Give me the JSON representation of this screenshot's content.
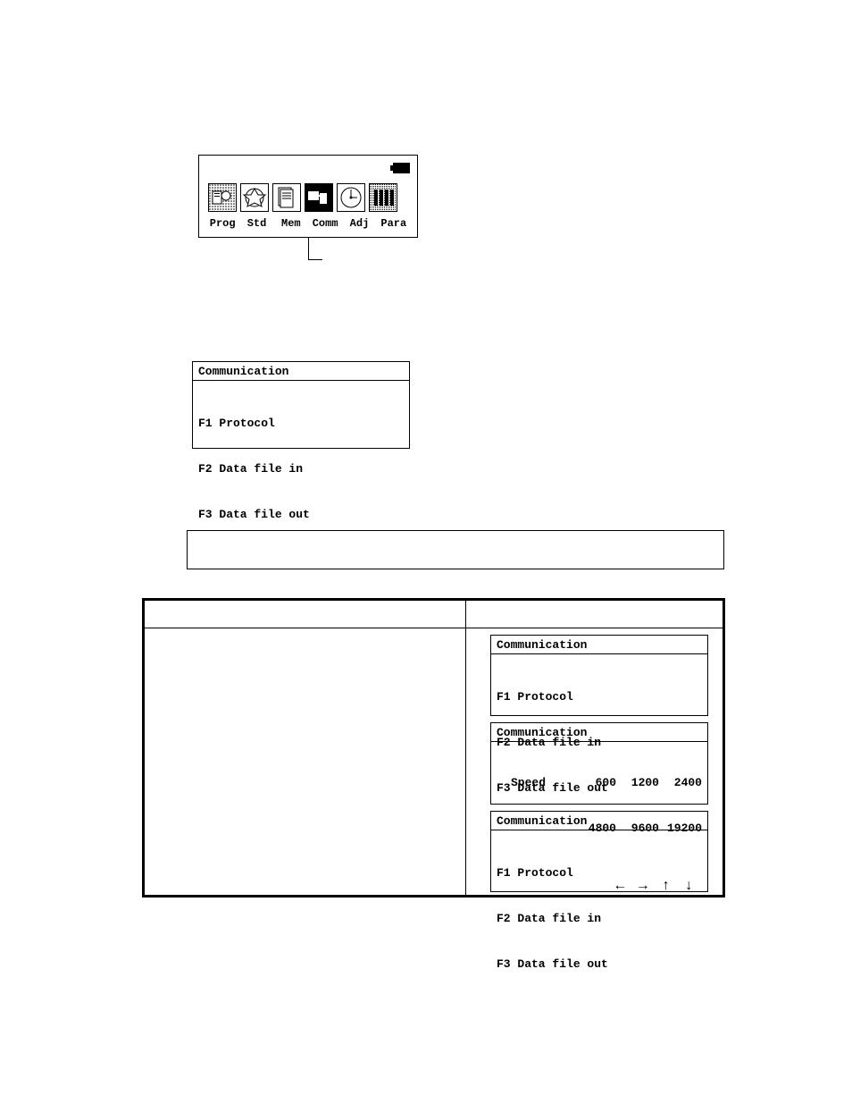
{
  "main_menu": {
    "labels": [
      "Prog",
      "Std",
      "Mem",
      "Comm",
      "Adj",
      "Para"
    ],
    "icons": [
      "prog-icon",
      "std-icon",
      "mem-icon",
      "comm-icon",
      "adj-icon",
      "para-icon"
    ],
    "battery": {
      "present": true,
      "level": "full"
    }
  },
  "comm_menu": {
    "title": "Communication",
    "items": [
      "F1 Protocol",
      "F2 Data file in",
      "F3 Data file out"
    ]
  },
  "speed_menu": {
    "title": "Communication",
    "label": "Speed",
    "row1": [
      "600",
      "1200",
      "2400"
    ],
    "row2": [
      "4800",
      "9600",
      "19200"
    ],
    "selected": "9600",
    "arrows": [
      "←",
      "→",
      "↑",
      "↓"
    ]
  }
}
